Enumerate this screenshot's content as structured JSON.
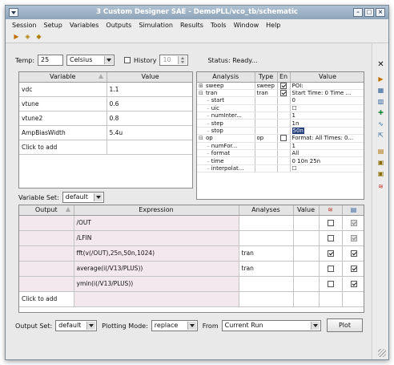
{
  "window": {
    "title": "3 Custom Designer SAE - DemoPLL/vco_tb/schematic",
    "buttons": [
      "–",
      "□",
      "×"
    ]
  },
  "menu": [
    "Session",
    "Setup",
    "Variables",
    "Outputs",
    "Simulation",
    "Results",
    "Tools",
    "Window",
    "Help"
  ],
  "temp": {
    "label": "Temp:",
    "value": "25",
    "unit": "Celsius",
    "history_label": "History",
    "history_value": "10",
    "status": "Status: Ready..."
  },
  "variables": {
    "columns": [
      "Variable",
      "Value"
    ],
    "rows": [
      {
        "name": "vdc",
        "value": "1.1"
      },
      {
        "name": "vtune",
        "value": "0.6"
      },
      {
        "name": "vtune2",
        "value": "0.8"
      },
      {
        "name": "AmpBiasWidth",
        "value": "5.4u"
      }
    ],
    "add_row": "Click to add",
    "set_label": "Variable Set:",
    "set_value": "default"
  },
  "analyses": {
    "columns": [
      "Analysis",
      "Type",
      "En",
      "Value"
    ],
    "rows": [
      {
        "indent": 0,
        "tree": "⊞",
        "name": "sweep",
        "type": "sweep",
        "en": "checked",
        "value": "POI:"
      },
      {
        "indent": 0,
        "tree": "⊟",
        "name": "tran",
        "type": "tran",
        "en": "checked",
        "value": "Start Time: 0 Time ..."
      },
      {
        "indent": 1,
        "tree": "",
        "name": "start",
        "type": "",
        "en": "",
        "value": "0"
      },
      {
        "indent": 1,
        "tree": "",
        "name": "uic",
        "type": "",
        "en": "",
        "value": "☐"
      },
      {
        "indent": 1,
        "tree": "",
        "name": "numInter...",
        "type": "",
        "en": "",
        "value": "1"
      },
      {
        "indent": 1,
        "tree": "",
        "name": "step",
        "type": "",
        "en": "",
        "value": "1n"
      },
      {
        "indent": 1,
        "tree": "",
        "name": "stop",
        "type": "",
        "en": "",
        "value": "50n",
        "selected": true
      },
      {
        "indent": 0,
        "tree": "⊟",
        "name": "op",
        "type": "op",
        "en": "unchecked",
        "value": "Format: All Times: 0..."
      },
      {
        "indent": 1,
        "tree": "",
        "name": "numFor...",
        "type": "",
        "en": "",
        "value": "1"
      },
      {
        "indent": 1,
        "tree": "",
        "name": "format",
        "type": "",
        "en": "",
        "value": "All"
      },
      {
        "indent": 1,
        "tree": "",
        "name": "time",
        "type": "",
        "en": "",
        "value": "0 10n 25n"
      },
      {
        "indent": 1,
        "tree": "",
        "name": "interpolat...",
        "type": "",
        "en": "",
        "value": "☐"
      }
    ]
  },
  "outputs": {
    "columns": [
      "Output",
      "Expression",
      "Analyses",
      "Value"
    ],
    "rows": [
      {
        "output": "",
        "expression": "/OUT",
        "analyses": "",
        "value": "",
        "plot": false,
        "save": true,
        "save_grey": true
      },
      {
        "output": "",
        "expression": "/LFIN",
        "analyses": "",
        "value": "",
        "plot": false,
        "save": true,
        "save_grey": true
      },
      {
        "output": "",
        "expression": "fft(v(/OUT),25n,50n,1024)",
        "analyses": "tran",
        "value": "",
        "plot": true,
        "save": true,
        "save_grey": false
      },
      {
        "output": "",
        "expression": "average(i(/V13/PLUS))",
        "analyses": "tran",
        "value": "",
        "plot": false,
        "save": true,
        "save_grey": false
      },
      {
        "output": "",
        "expression": "ymin(i(/V13/PLUS))",
        "analyses": "",
        "value": "",
        "plot": false,
        "save": true,
        "save_grey": false
      }
    ],
    "add_row": "Click to add"
  },
  "bottom": {
    "output_set_label": "Output Set:",
    "output_set_value": "default",
    "plotting_mode_label": "Plotting Mode:",
    "plotting_mode_value": "replace",
    "from_label": "From",
    "from_value": "Current Run",
    "plot_button": "Plot"
  },
  "colors": {
    "titlebar": "#9db1c5",
    "selection": "#243f7a",
    "row_tint": "#f3e8ed"
  }
}
